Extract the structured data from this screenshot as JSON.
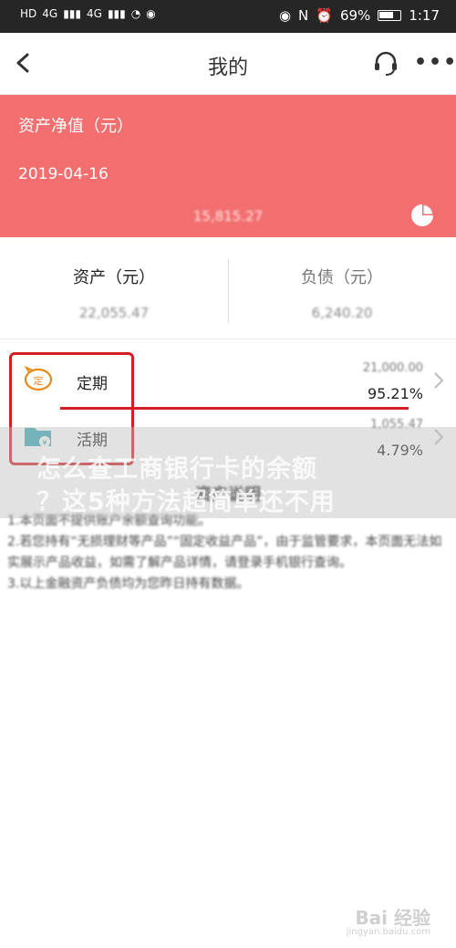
{
  "status": {
    "left_icons": [
      "HD",
      "4G",
      "signal-icon",
      "4G",
      "signal-icon",
      "wifi-icon",
      "location-icon"
    ],
    "right_icons": [
      "eye-icon",
      "nfc-icon",
      "alarm-icon"
    ],
    "battery": "69%",
    "time": "1:17"
  },
  "nav": {
    "title": "我的"
  },
  "banner": {
    "label": "资产净值（元）",
    "date": "2019-04-16",
    "value": "15,815.27"
  },
  "stats": {
    "assets_label": "资产（元）",
    "assets_value": "22,055.47",
    "liabilities_label": "负债（元）",
    "liabilities_value": "6,240.20"
  },
  "rows": [
    {
      "name": "定期",
      "amount": "21,000.00",
      "pct": "95.21%",
      "icon": "time-deposit-icon"
    },
    {
      "name": "活期",
      "amount": "1,055.47",
      "pct": "4.79%",
      "icon": "demand-deposit-icon"
    }
  ],
  "overlay": {
    "line1": "怎么查工商银行卡的余额",
    "line2": "？这5种方法超简单还不用"
  },
  "notes": {
    "head": "资产说明",
    "lines": [
      "1.本页面不提供账户余额查询功能。",
      "2.若您持有“无损理财等产品”“固定收益产品”，由于监管要求，本页面无法如实展示产品收益，如需了解产品详情，请登录手机银行查询。",
      "3.以上金融资产负债均为您昨日持有数据。"
    ]
  },
  "watermark": {
    "brand": "Bai 经验",
    "url": "jingyan.baidu.com"
  },
  "colors": {
    "banner": "#f36f6f",
    "highlight": "#d51e24",
    "statusbar": "#262626"
  }
}
